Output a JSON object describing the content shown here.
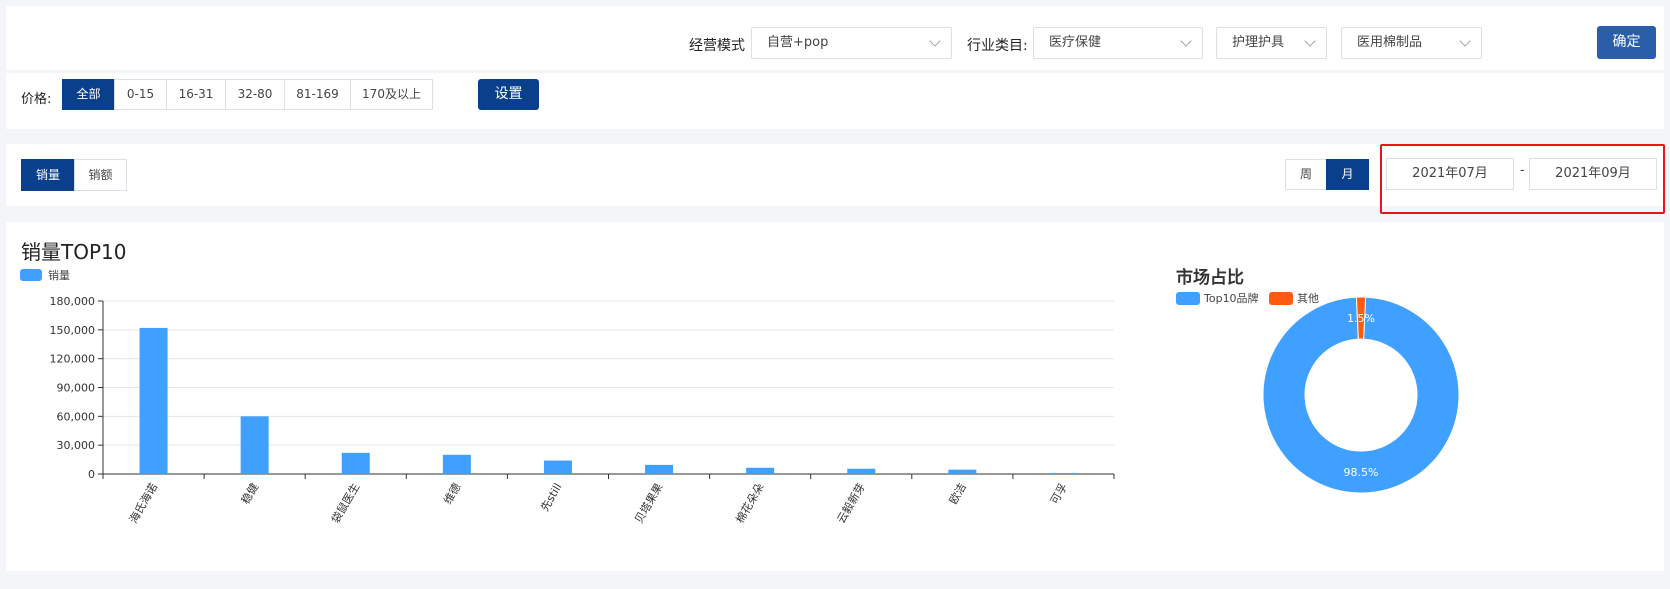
{
  "filters": {
    "mode_label": "经营模式",
    "mode_value": "自营+pop",
    "industry_label": "行业类目:",
    "industry_value_1": "医疗保健",
    "industry_value_2": "护理护具",
    "industry_value_3": "医用棉制品",
    "confirm_label": "确定"
  },
  "price": {
    "label": "价格:",
    "options": [
      "全部",
      "0-15",
      "16-31",
      "32-80",
      "81-169",
      "170及以上"
    ],
    "selected": "全部",
    "settings_label": "设置"
  },
  "toggles": {
    "metric_options": [
      "销量",
      "销额"
    ],
    "metric_selected": "销量",
    "period_options": [
      "周",
      "月"
    ],
    "period_selected": "月",
    "date_start": "2021年07月",
    "date_separator": "-",
    "date_end": "2021年09月"
  },
  "colors": {
    "primary": "#0a3f8c",
    "confirm": "#2a5ea8",
    "bar": "#40a0ff",
    "pie_other": "#ff5a10",
    "highlight": "#e8151b"
  },
  "chart_title": "销量TOP10",
  "chart_data": [
    {
      "type": "bar",
      "title": "",
      "legend": [
        "销量"
      ],
      "categories": [
        "海氏海诺",
        "稳健",
        "袋鼠医生",
        "维德",
        "先still",
        "贝塔果果",
        "棉花朵朵",
        "云毅新芽",
        "欧洁",
        "可孚"
      ],
      "series": [
        {
          "name": "销量",
          "values": [
            152000,
            60000,
            22000,
            20000,
            14000,
            9500,
            6500,
            5500,
            4500,
            1000
          ]
        }
      ],
      "ylim": [
        0,
        180000
      ],
      "yticks": [
        "0",
        "30,000",
        "60,000",
        "90,000",
        "120,000",
        "150,000",
        "180,000"
      ],
      "grid": true,
      "legend_position": "top-left"
    },
    {
      "type": "pie",
      "title": "市场占比",
      "categories": [
        "Top10品牌",
        "其他"
      ],
      "values": [
        98.5,
        1.5
      ],
      "labels": [
        "98.5%",
        "1.5%"
      ],
      "donut": true,
      "legend_position": "top-left"
    }
  ]
}
